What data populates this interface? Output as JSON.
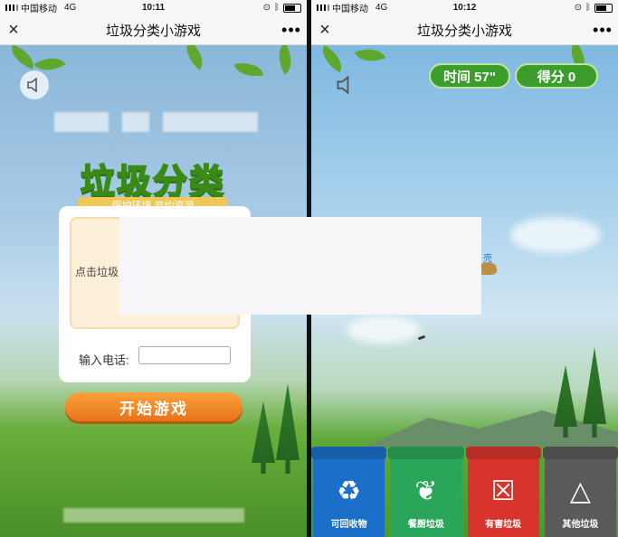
{
  "left": {
    "status": {
      "carrier": "中国移动",
      "network": "4G",
      "time": "10:11"
    },
    "nav": {
      "close": "×",
      "title": "垃圾分类小游戏",
      "more": "•••"
    },
    "logo": {
      "title": "垃圾分类",
      "tagline": "保护环境 节约资源"
    },
    "card": {
      "hint": "点击垃圾",
      "phone_label": "输入电话:",
      "phone_value": ""
    },
    "start_button": "开始游戏"
  },
  "right": {
    "status": {
      "carrier": "中国移动",
      "network": "4G",
      "time": "10:12"
    },
    "nav": {
      "close": "×",
      "title": "垃圾分类小游戏",
      "more": "•••"
    },
    "time_pill": "时间 57\"",
    "score_pill": "得分 0",
    "partial_label": "壳",
    "bins": [
      {
        "name": "可回收物",
        "color": "#1b6fc9",
        "icon": "recycle-icon"
      },
      {
        "name": "餐厨垃圾",
        "color": "#2aa65a",
        "icon": "kitchen-waste-icon"
      },
      {
        "name": "有害垃圾",
        "color": "#d9342b",
        "icon": "hazardous-icon"
      },
      {
        "name": "其他垃圾",
        "color": "#5a5a5a",
        "icon": "other-waste-icon"
      }
    ]
  }
}
